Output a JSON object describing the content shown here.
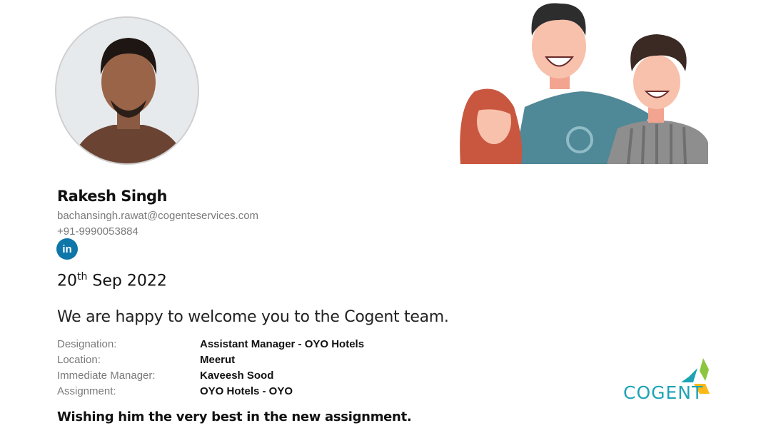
{
  "profile": {
    "name": "Rakesh Singh",
    "email": "bachansingh.rawat@cogenteservices.com",
    "phone": "+91-9990053884",
    "linkedin_label": "in"
  },
  "date": {
    "day": "20",
    "suffix": "th",
    "rest": "Sep 2022"
  },
  "welcome": "We are happy to welcome you to the Cogent team.",
  "details": [
    {
      "label": "Designation:",
      "value": "Assistant Manager - OYO Hotels"
    },
    {
      "label": "Location:",
      "value": "Meerut"
    },
    {
      "label": "Immediate Manager:",
      "value": "Kaveesh Sood"
    },
    {
      "label": "Assignment:",
      "value": "OYO Hotels - OYO"
    }
  ],
  "closing": "Wishing him the very best in the new assignment.",
  "logo": {
    "text": "COGENT"
  },
  "colors": {
    "linkedin": "#0e76a8",
    "brand": "#1ea3b5"
  }
}
